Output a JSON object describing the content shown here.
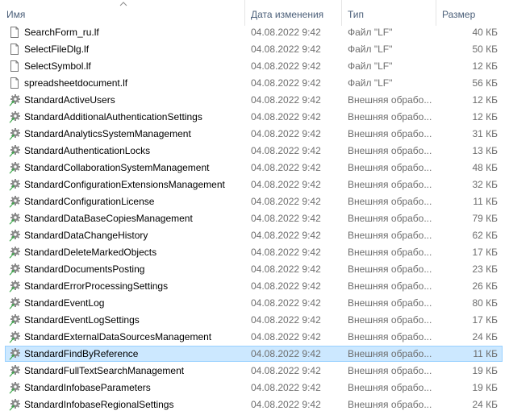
{
  "columns": {
    "name": "Имя",
    "date": "Дата изменения",
    "type": "Тип",
    "size": "Размер"
  },
  "files": [
    {
      "name": "SearchForm_ru.lf",
      "date": "04.08.2022 9:42",
      "type": "Файл \"LF\"",
      "size": "40 КБ",
      "icon": "document-icon"
    },
    {
      "name": "SelectFileDlg.lf",
      "date": "04.08.2022 9:42",
      "type": "Файл \"LF\"",
      "size": "50 КБ",
      "icon": "document-icon"
    },
    {
      "name": "SelectSymbol.lf",
      "date": "04.08.2022 9:42",
      "type": "Файл \"LF\"",
      "size": "12 КБ",
      "icon": "document-icon"
    },
    {
      "name": "spreadsheetdocument.lf",
      "date": "04.08.2022 9:42",
      "type": "Файл \"LF\"",
      "size": "56 КБ",
      "icon": "document-icon"
    },
    {
      "name": "StandardActiveUsers",
      "date": "04.08.2022 9:42",
      "type": "Внешняя обрабо...",
      "size": "12 КБ",
      "icon": "gear-icon"
    },
    {
      "name": "StandardAdditionalAuthenticationSettings",
      "date": "04.08.2022 9:42",
      "type": "Внешняя обрабо...",
      "size": "12 КБ",
      "icon": "gear-icon"
    },
    {
      "name": "StandardAnalyticsSystemManagement",
      "date": "04.08.2022 9:42",
      "type": "Внешняя обрабо...",
      "size": "31 КБ",
      "icon": "gear-icon"
    },
    {
      "name": "StandardAuthenticationLocks",
      "date": "04.08.2022 9:42",
      "type": "Внешняя обрабо...",
      "size": "13 КБ",
      "icon": "gear-icon"
    },
    {
      "name": "StandardCollaborationSystemManagement",
      "date": "04.08.2022 9:42",
      "type": "Внешняя обрабо...",
      "size": "48 КБ",
      "icon": "gear-icon"
    },
    {
      "name": "StandardConfigurationExtensionsManagement",
      "date": "04.08.2022 9:42",
      "type": "Внешняя обрабо...",
      "size": "32 КБ",
      "icon": "gear-icon"
    },
    {
      "name": "StandardConfigurationLicense",
      "date": "04.08.2022 9:42",
      "type": "Внешняя обрабо...",
      "size": "11 КБ",
      "icon": "gear-icon"
    },
    {
      "name": "StandardDataBaseCopiesManagement",
      "date": "04.08.2022 9:42",
      "type": "Внешняя обрабо...",
      "size": "79 КБ",
      "icon": "gear-icon"
    },
    {
      "name": "StandardDataChangeHistory",
      "date": "04.08.2022 9:42",
      "type": "Внешняя обрабо...",
      "size": "62 КБ",
      "icon": "gear-icon"
    },
    {
      "name": "StandardDeleteMarkedObjects",
      "date": "04.08.2022 9:42",
      "type": "Внешняя обрабо...",
      "size": "17 КБ",
      "icon": "gear-icon"
    },
    {
      "name": "StandardDocumentsPosting",
      "date": "04.08.2022 9:42",
      "type": "Внешняя обрабо...",
      "size": "23 КБ",
      "icon": "gear-icon"
    },
    {
      "name": "StandardErrorProcessingSettings",
      "date": "04.08.2022 9:42",
      "type": "Внешняя обрабо...",
      "size": "26 КБ",
      "icon": "gear-icon"
    },
    {
      "name": "StandardEventLog",
      "date": "04.08.2022 9:42",
      "type": "Внешняя обрабо...",
      "size": "80 КБ",
      "icon": "gear-icon"
    },
    {
      "name": "StandardEventLogSettings",
      "date": "04.08.2022 9:42",
      "type": "Внешняя обрабо...",
      "size": "17 КБ",
      "icon": "gear-icon"
    },
    {
      "name": "StandardExternalDataSourcesManagement",
      "date": "04.08.2022 9:42",
      "type": "Внешняя обрабо...",
      "size": "24 КБ",
      "icon": "gear-icon"
    },
    {
      "name": "StandardFindByReference",
      "date": "04.08.2022 9:42",
      "type": "Внешняя обрабо...",
      "size": "11 КБ",
      "icon": "gear-icon",
      "selected": true
    },
    {
      "name": "StandardFullTextSearchManagement",
      "date": "04.08.2022 9:42",
      "type": "Внешняя обрабо...",
      "size": "19 КБ",
      "icon": "gear-icon"
    },
    {
      "name": "StandardInfobaseParameters",
      "date": "04.08.2022 9:42",
      "type": "Внешняя обрабо...",
      "size": "19 КБ",
      "icon": "gear-icon"
    },
    {
      "name": "StandardInfobaseRegionalSettings",
      "date": "04.08.2022 9:42",
      "type": "Внешняя обрабо...",
      "size": "24 КБ",
      "icon": "gear-icon"
    }
  ],
  "colors": {
    "header_text": "#4c607a",
    "meta_text": "#6d6d6d",
    "selection_fill": "#cce8ff",
    "selection_border": "#99d1ff",
    "gear_gray": "#8a8a8a",
    "arrow_green": "#3aa548"
  }
}
